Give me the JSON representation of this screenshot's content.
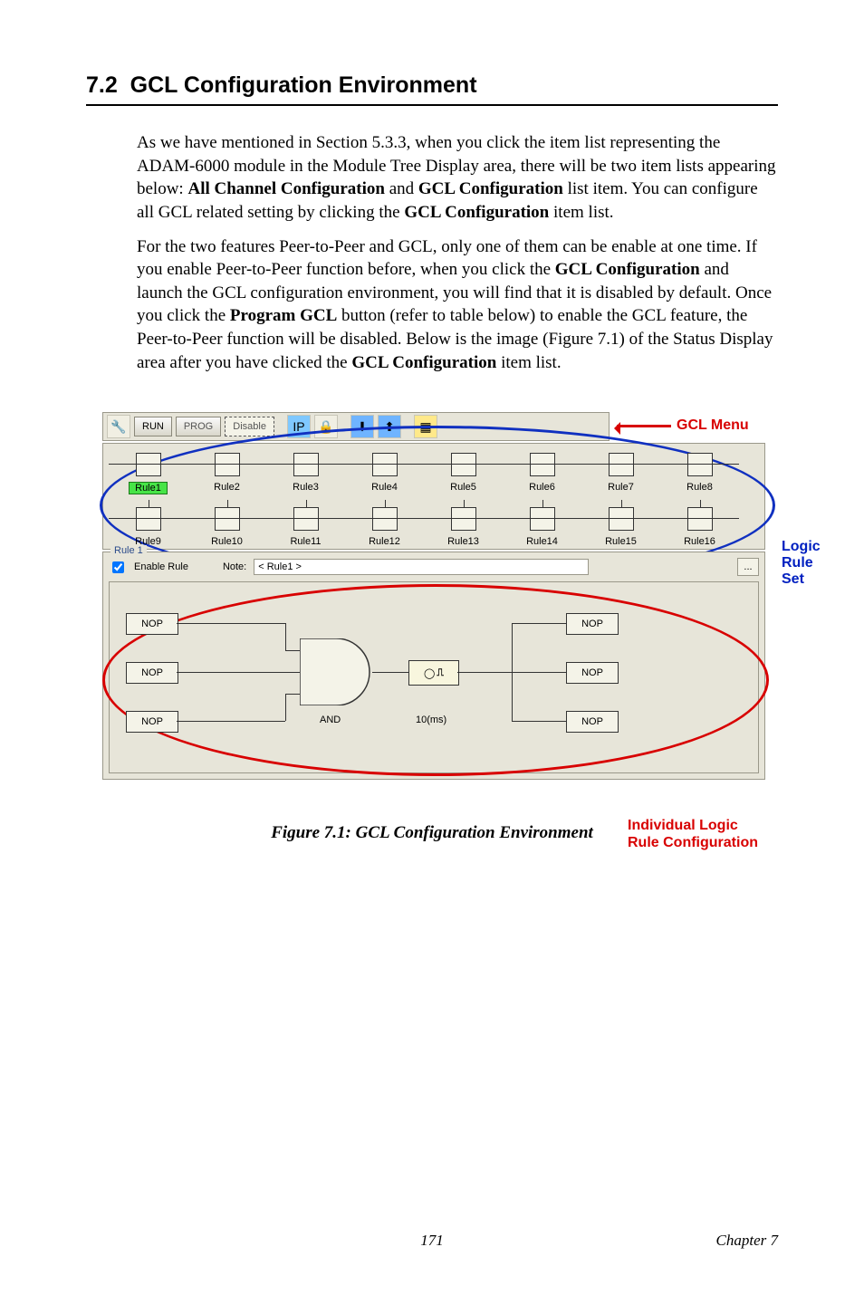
{
  "section": {
    "number": "7.2",
    "title": "GCL Configuration Environment"
  },
  "paragraphs": {
    "p1_a": "As we have mentioned in Section 5.3.3, when you click the item list representing the ADAM-6000 module in the Module Tree Display area, there will be two item lists appearing below: ",
    "p1_b_bold": "All Channel Configuration",
    "p1_c": " and ",
    "p1_d_bold": "GCL Configuration",
    "p1_e": " list item. You can configure all GCL related setting by clicking the ",
    "p1_f_bold": "GCL Configuration",
    "p1_g": " item list.",
    "p2_a": "For the two features Peer-to-Peer and GCL, only one of them can be enable at one time. If you enable Peer-to-Peer function before, when you click the ",
    "p2_b_bold": "GCL Configuration",
    "p2_c": " and launch the GCL configuration environment, you will find that it is disabled by default. Once you click the ",
    "p2_d_bold": "Program GCL",
    "p2_e": " button (refer to table below) to enable the GCL feature, the Peer-to-Peer function will be disabled. Below is the image (Figure 7.1) of the Status Display area after you have clicked the ",
    "p2_f_bold": "GCL Configuration",
    "p2_g": " item list."
  },
  "toolbar": {
    "run": "RUN",
    "prog": "PROG",
    "disable": "Disable",
    "ip_label": "IP"
  },
  "annotations": {
    "gcl_menu": "GCL Menu",
    "logic_rule_set_l1": "Logic",
    "logic_rule_set_l2": "Rule Set",
    "indiv_l1": "Individual Logic",
    "indiv_l2": "Rule Configuration"
  },
  "rules": {
    "row1": [
      "Rule1",
      "Rule2",
      "Rule3",
      "Rule4",
      "Rule5",
      "Rule6",
      "Rule7",
      "Rule8"
    ],
    "row2": [
      "Rule9",
      "Rule10",
      "Rule11",
      "Rule12",
      "Rule13",
      "Rule14",
      "Rule15",
      "Rule16"
    ]
  },
  "rule1_panel": {
    "frame_title": "Rule 1",
    "enable_label": "Enable Rule",
    "note_label": "Note:",
    "note_value": "< Rule1 >",
    "ellipsis": "..."
  },
  "logic": {
    "nop": "NOP",
    "gate": "AND",
    "delay": "10(ms)"
  },
  "figure_caption": "Figure 7.1: GCL Configuration Environment",
  "footer": {
    "page": "171",
    "chapter": "Chapter 7"
  }
}
